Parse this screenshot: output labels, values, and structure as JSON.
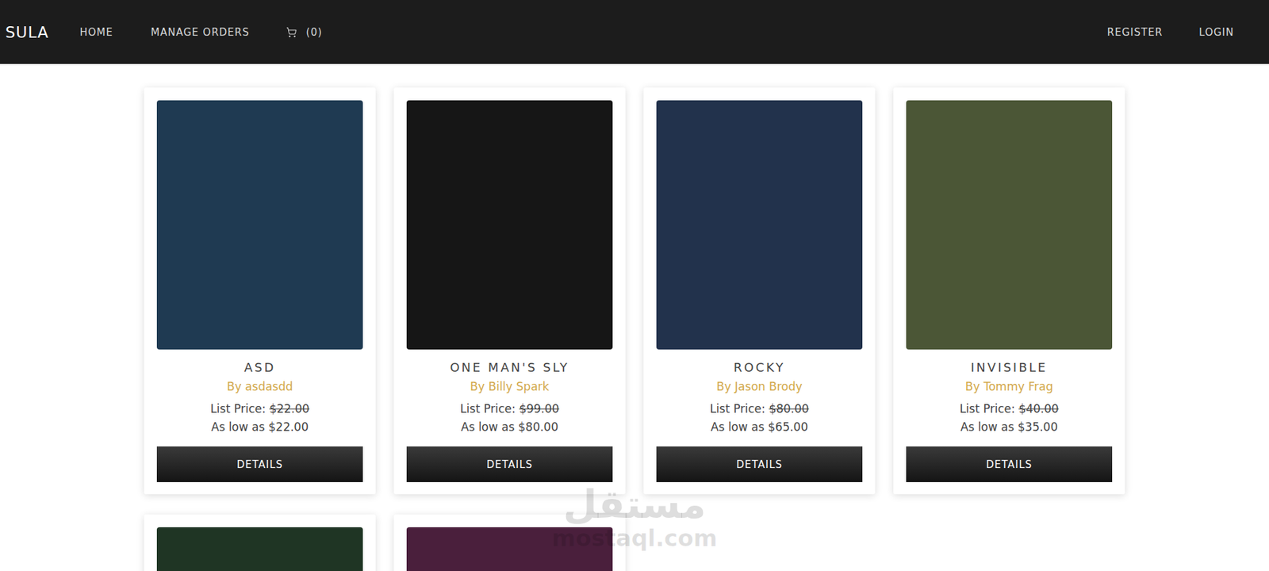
{
  "nav": {
    "brand": "SULA",
    "links": [
      {
        "label": "HOME"
      },
      {
        "label": "MANAGE ORDERS"
      }
    ],
    "cart_count": "(0)",
    "right_links": [
      {
        "label": "REGISTER"
      },
      {
        "label": "LOGIN"
      }
    ]
  },
  "books": [
    {
      "title": "ASD",
      "by": "By",
      "author": "asdasdd",
      "list_label": "List Price:",
      "list_price": "$22.00",
      "sale": "As low as $22.00",
      "button": "DETAILS",
      "color": "#1f3a52"
    },
    {
      "title": "ONE MAN'S SLY",
      "by": "By",
      "author": "Billy Spark",
      "list_label": "List Price:",
      "list_price": "$99.00",
      "sale": "As low as $80.00",
      "button": "DETAILS",
      "color": "#161616"
    },
    {
      "title": "ROCKY",
      "by": "By",
      "author": "Jason Brody",
      "list_label": "List Price:",
      "list_price": "$80.00",
      "sale": "As low as $65.00",
      "button": "DETAILS",
      "color": "#22324c"
    },
    {
      "title": "INVISIBLE",
      "by": "By",
      "author": "Tommy Frag",
      "list_label": "List Price:",
      "list_price": "$40.00",
      "sale": "As low as $35.00",
      "button": "DETAILS",
      "color": "#4b5636"
    }
  ],
  "more_books": [
    {
      "color": "#1f3524"
    },
    {
      "color": "#4a1f3c"
    }
  ],
  "watermark": {
    "script": "مستقل",
    "site": "mostaql.com"
  }
}
